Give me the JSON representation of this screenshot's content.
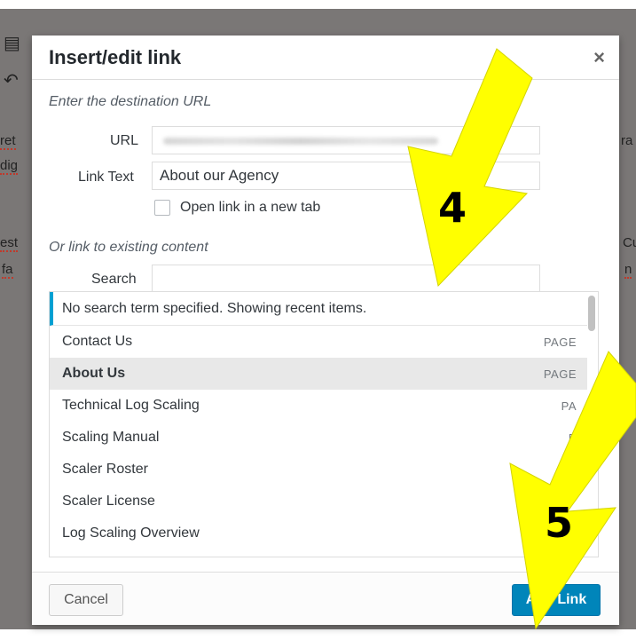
{
  "background": {
    "fragments": [
      "ret",
      "dig",
      "est",
      "fa",
      "ra",
      "Cu",
      "n"
    ]
  },
  "modal": {
    "title": "Insert/edit link",
    "close_glyph": "×",
    "url_section_label": "Enter the destination URL",
    "url_label": "URL",
    "url_value": "",
    "link_text_label": "Link Text",
    "link_text_value": "About our Agency",
    "new_tab_label": "Open link in a new tab",
    "new_tab_checked": false,
    "existing_section_label": "Or link to existing content",
    "search_label": "Search",
    "search_value": "",
    "notice": "No search term specified. Showing recent items.",
    "results": [
      {
        "title": "Contact Us",
        "type": "PAGE"
      },
      {
        "title": "About Us",
        "type": "PAGE"
      },
      {
        "title": "Technical Log Scaling",
        "type": "PA"
      },
      {
        "title": "Scaling Manual",
        "type": "P"
      },
      {
        "title": "Scaler Roster",
        "type": ""
      },
      {
        "title": "Scaler License",
        "type": ""
      },
      {
        "title": "Log Scaling Overview",
        "type": ""
      }
    ],
    "cancel_label": "Cancel",
    "add_link_label": "Add Link"
  },
  "annotations": {
    "step_4": "4",
    "step_5": "5",
    "arrow_color": "#ffff00",
    "accent_color": "#00a0d2",
    "button_color": "#0085ba"
  }
}
